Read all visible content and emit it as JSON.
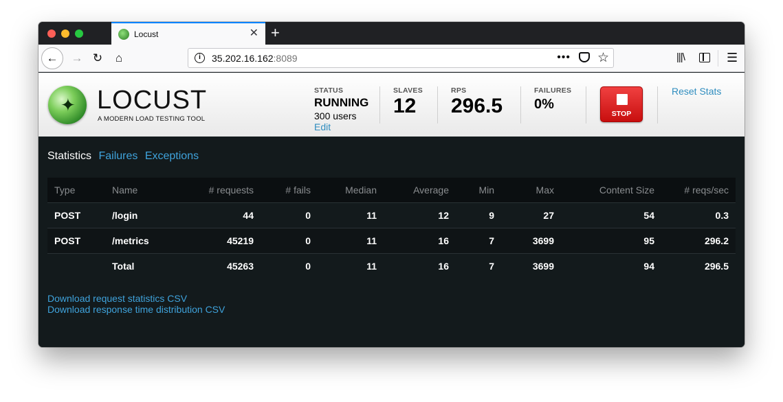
{
  "browser": {
    "tab_title": "Locust",
    "url_host": "35.202.16.162",
    "url_port": ":8089"
  },
  "app": {
    "logo_title": "LOCUST",
    "logo_tagline": "A MODERN LOAD TESTING TOOL"
  },
  "header": {
    "status": {
      "label": "STATUS",
      "value": "RUNNING",
      "users": "300 users",
      "edit": "Edit"
    },
    "slaves": {
      "label": "SLAVES",
      "value": "12"
    },
    "rps": {
      "label": "RPS",
      "value": "296.5"
    },
    "failures": {
      "label": "FAILURES",
      "value": "0%"
    },
    "stop_label": "STOP",
    "reset_stats": "Reset Stats"
  },
  "tabs": [
    {
      "label": "Statistics",
      "active": true
    },
    {
      "label": "Failures",
      "active": false
    },
    {
      "label": "Exceptions",
      "active": false
    }
  ],
  "table": {
    "columns": [
      "Type",
      "Name",
      "# requests",
      "# fails",
      "Median",
      "Average",
      "Min",
      "Max",
      "Content Size",
      "# reqs/sec"
    ],
    "rows": [
      [
        "POST",
        "/login",
        "44",
        "0",
        "11",
        "12",
        "9",
        "27",
        "54",
        "0.3"
      ],
      [
        "POST",
        "/metrics",
        "45219",
        "0",
        "11",
        "16",
        "7",
        "3699",
        "95",
        "296.2"
      ],
      [
        "",
        "Total",
        "45263",
        "0",
        "11",
        "16",
        "7",
        "3699",
        "94",
        "296.5"
      ]
    ]
  },
  "downloads": {
    "request_stats": "Download request statistics CSV",
    "response_dist": "Download response time distribution CSV"
  },
  "colors": {
    "accent": "#3fa3dc",
    "stop_red": "#e02828",
    "panel_dark": "#131a1c"
  }
}
